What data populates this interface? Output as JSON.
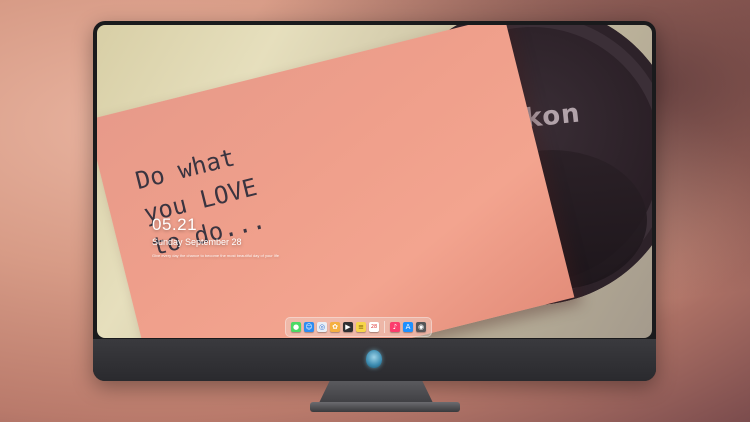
{
  "wallpaper": {
    "brand_text": "Nikon",
    "note_lines": "Do what\nyou LOVE\nto do...",
    "note_face": "^ ^\n ◡"
  },
  "clock": {
    "time": "05.21",
    "date": "Sunday September 28",
    "quote": "Give every day the chance to become the most beautiful day of your life"
  },
  "dock": {
    "apps": [
      {
        "name": "messages",
        "color": "#4cd964",
        "glyph": "●"
      },
      {
        "name": "finder",
        "color": "#2d8cf0",
        "glyph": "☺"
      },
      {
        "name": "safari",
        "color": "#e9eef5",
        "glyph": "◎"
      },
      {
        "name": "photos",
        "color": "#f5b041",
        "glyph": "✿"
      },
      {
        "name": "clapper",
        "color": "#2f2f33",
        "glyph": "▶"
      },
      {
        "name": "notes",
        "color": "#f7d54a",
        "glyph": "≡"
      },
      {
        "name": "calendar",
        "color": "#ffffff",
        "glyph": "28"
      },
      {
        "name": "music",
        "color": "#fc3c6c",
        "glyph": "♪"
      },
      {
        "name": "appstore",
        "color": "#1e90ff",
        "glyph": "A"
      },
      {
        "name": "camera",
        "color": "#555558",
        "glyph": "◉"
      }
    ]
  },
  "colors": {
    "monitor_frame": "#1a1a1c",
    "chin": "#2f2f33",
    "sticky_note": "#ef9f8b"
  }
}
